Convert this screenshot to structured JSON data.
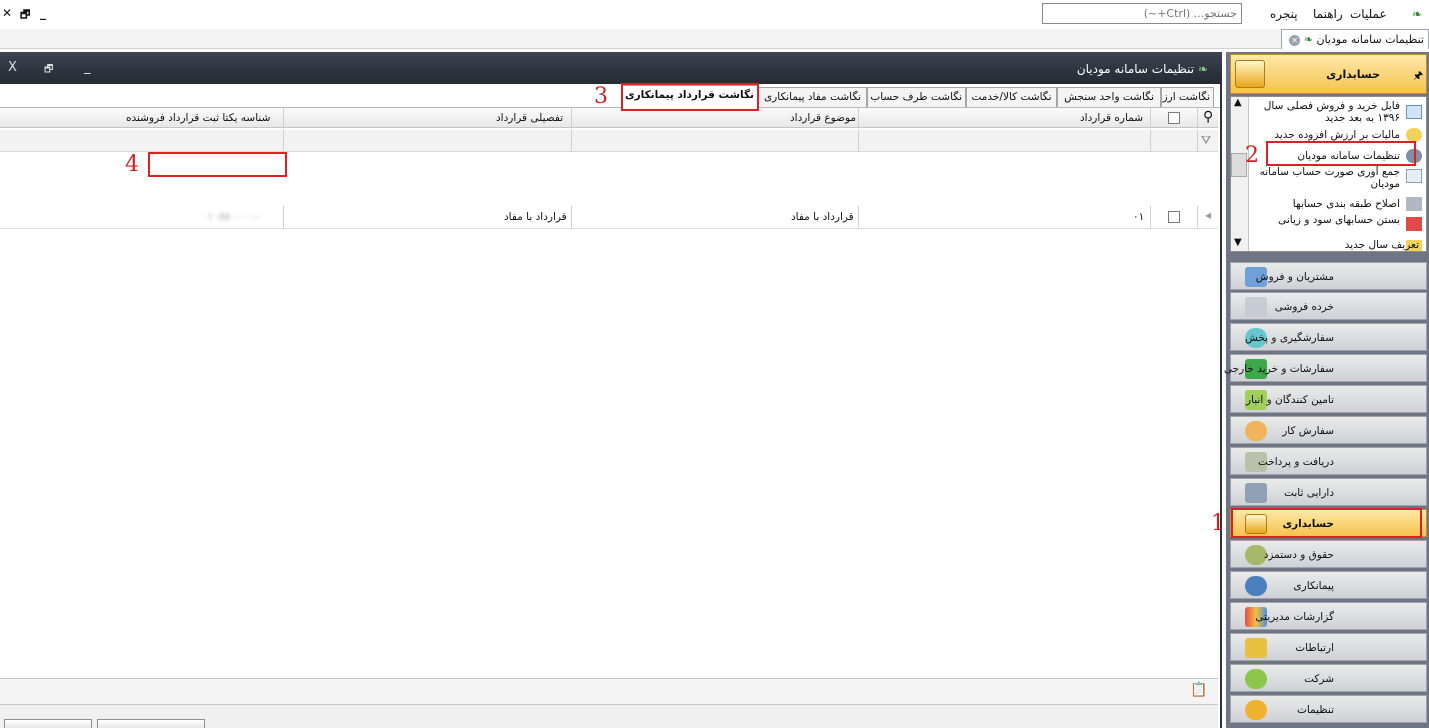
{
  "menubar": {
    "items": [
      "عملیات",
      "راهنما",
      "پنجره"
    ],
    "search_placeholder": "جستجو... (Ctrl+~)",
    "window_controls": [
      "_",
      "🗗",
      "✕"
    ]
  },
  "doc_tab": {
    "label": "تنظیمات سامانه مودیان"
  },
  "inner_window": {
    "title": "تنظیمات سامانه مودیان",
    "controls": [
      "_",
      "🗗",
      "X"
    ]
  },
  "subtabs": [
    "نگاشت ارز",
    "نگاشت واحد سنجش",
    "نگاشت کالا/خدمت",
    "نگاشت طرف حساب",
    "نگاشت مفاد پیمانکاری",
    "نگاشت قرارداد پیمانکاری"
  ],
  "active_subtab_index": 5,
  "grid": {
    "columns": [
      "شماره قرارداد",
      "موضوع قرارداد",
      "تفصیلی قرارداد",
      "شناسه یکتا ثبت قرارداد فروشنده"
    ],
    "rows": [
      {
        "number": "۰۱",
        "subject": "قرارداد با مفاد",
        "detail": "قرارداد با مفاد",
        "unique_id": "٠-٠١٠٥٥٠٠٠٠"
      }
    ]
  },
  "annotations": [
    "1",
    "2",
    "3",
    "4"
  ],
  "sidebar": {
    "header_title": "حسابداری",
    "list_items": [
      "فایل خرید و فروش فصلی سال ۱۳۹۶ به بعد جدید",
      "مالیات بر ارزش افزوده جدید",
      "تنظیمات سامانه مودیان",
      "جمع آوری صورت حساب سامانه مودیان",
      "اصلاح طبقه بندی حسابها",
      "بستن حسابهای سود و زیانی",
      "تعریف سال جدید"
    ],
    "modules": [
      "مشتریان و فروش",
      "خرده فروشی",
      "سفارشگیری و پخش",
      "سفارشات و خرید خارجی",
      "تامین کنندگان و انبار",
      "سفارش کار",
      "دریافت و پرداخت",
      "دارایی ثابت",
      "حسابداری",
      "حقوق و دستمزد",
      "پیمانکاری",
      "گزارشات مدیریتی",
      "ارتباطات",
      "شرکت",
      "تنظیمات"
    ],
    "active_module_index": 8
  },
  "colors": {
    "accent_orange": "#f6c24e",
    "annotation_red": "#e02020",
    "titlebar_dark": "#2b3340"
  }
}
